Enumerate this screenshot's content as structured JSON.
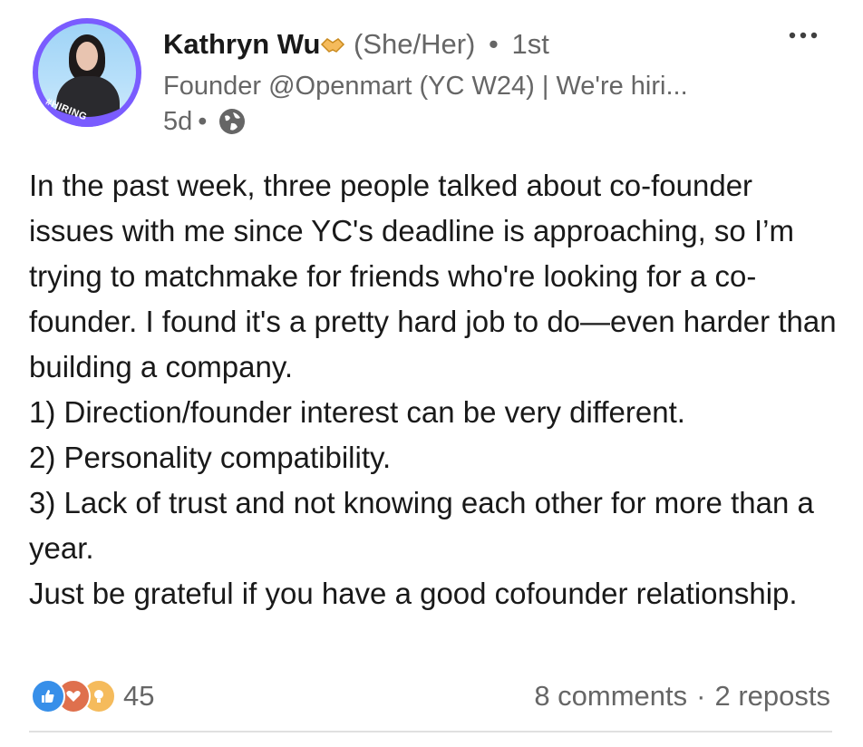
{
  "author": {
    "name": "Kathryn Wu",
    "pronouns": "(She/Her)",
    "separator": "•",
    "degree": "1st",
    "headline": "Founder @Openmart (YC W24) | We're hiri...",
    "time": "5d",
    "time_separator": "•",
    "avatar_badge": "#HIRING",
    "name_emoji_icon": "handshake-icon",
    "visibility_icon": "globe-icon"
  },
  "post": {
    "text": "In the past week, three people talked about co-founder issues with me since YC's deadline is approaching, so I’m trying to matchmake for friends who're looking for a co-founder. I found it's a pretty hard job to do—even harder than building a company.\n1) Direction/founder interest can be very different.\n2) Personality compatibility.\n3) Lack of trust and not knowing each other for more than a year.\nJust be grateful if you have a good cofounder relationship."
  },
  "social": {
    "reaction_icons": [
      "like-icon",
      "love-icon",
      "insightful-icon"
    ],
    "reaction_count": "45",
    "comments": "8 comments",
    "separator": "·",
    "reposts": "2 reposts"
  },
  "colors": {
    "text_primary": "#191919",
    "text_secondary": "#666666",
    "avatar_ring": "#7a5cff",
    "like_blue": "#378fe9",
    "love_red": "#df704d",
    "insightful_yellow": "#f5bb5c",
    "divider": "#e0e0e0"
  }
}
